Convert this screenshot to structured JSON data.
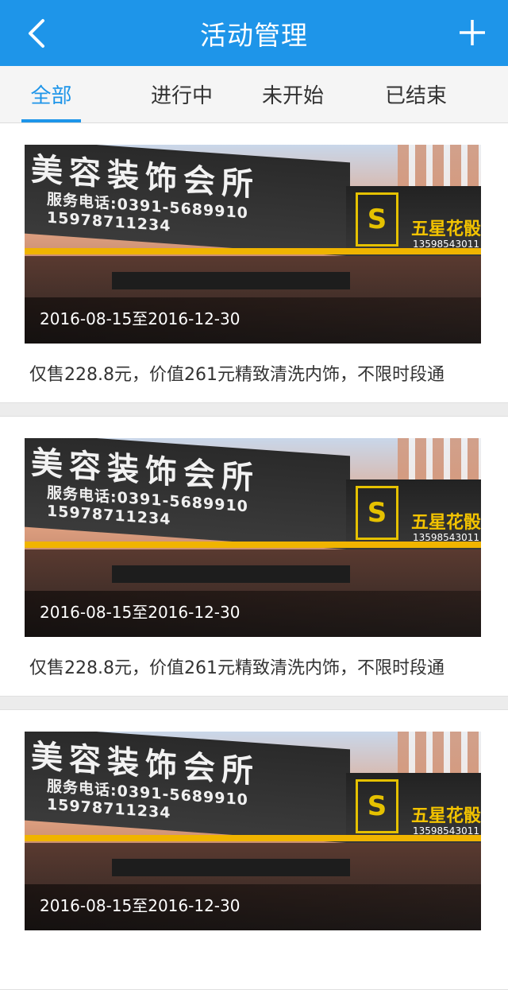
{
  "header": {
    "title": "活动管理",
    "back_icon": "chevron-left-icon",
    "add_icon": "plus-icon",
    "color": "#1e95e9"
  },
  "tabs": [
    {
      "label": "全部",
      "active": true
    },
    {
      "label": "进行中",
      "active": false
    },
    {
      "label": "未开始",
      "active": false
    },
    {
      "label": "已结束",
      "active": false
    }
  ],
  "activities": [
    {
      "date": "2016-08-15至2016-12-30",
      "description": "仅售228.8元，价值261元精致清洗内饰，不限时段通",
      "image": {
        "sign_title": "美容装饰会所",
        "sign_phone": "服务电话:0391-5689910  15978711234",
        "right_brand": "五星花骰",
        "right_phone": "13598543011"
      }
    },
    {
      "date": "2016-08-15至2016-12-30",
      "description": "仅售228.8元，价值261元精致清洗内饰，不限时段通",
      "image": {
        "sign_title": "美容装饰会所",
        "sign_phone": "服务电话:0391-5689910  15978711234",
        "right_brand": "五星花骰",
        "right_phone": "13598543011"
      }
    },
    {
      "date": "2016-08-15至2016-12-30",
      "description": "",
      "image": {
        "sign_title": "美容装饰会所",
        "sign_phone": "服务电话:0391-5689910  15978711234",
        "right_brand": "五星花骰",
        "right_phone": "13598543011"
      }
    }
  ]
}
